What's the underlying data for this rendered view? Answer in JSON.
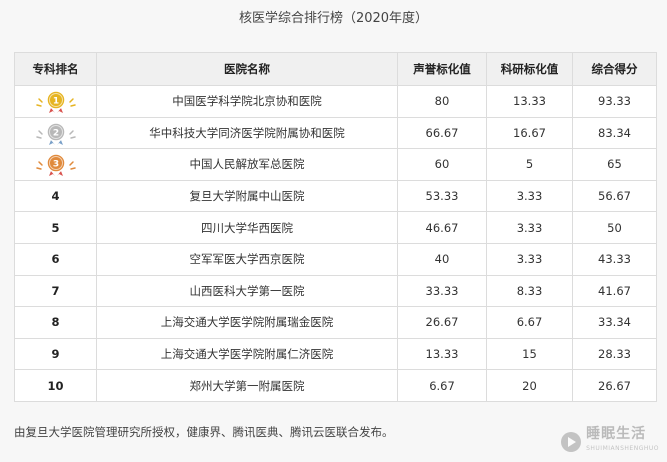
{
  "title": "核医学综合排行榜（2020年度）",
  "headers": [
    "专科排名",
    "医院名称",
    "声誉标化值",
    "科研标化值",
    "综合得分"
  ],
  "rows": [
    {
      "rank": "1",
      "medal": "gold",
      "hospital": "中国医学科学院北京协和医院",
      "reputation": "80",
      "research": "13.33",
      "total": "93.33"
    },
    {
      "rank": "2",
      "medal": "silver",
      "hospital": "华中科技大学同济医学院附属协和医院",
      "reputation": "66.67",
      "research": "16.67",
      "total": "83.34"
    },
    {
      "rank": "3",
      "medal": "bronze",
      "hospital": "中国人民解放军总医院",
      "reputation": "60",
      "research": "5",
      "total": "65"
    },
    {
      "rank": "4",
      "hospital": "复旦大学附属中山医院",
      "reputation": "53.33",
      "research": "3.33",
      "total": "56.67"
    },
    {
      "rank": "5",
      "hospital": "四川大学华西医院",
      "reputation": "46.67",
      "research": "3.33",
      "total": "50"
    },
    {
      "rank": "6",
      "hospital": "空军军医大学西京医院",
      "reputation": "40",
      "research": "3.33",
      "total": "43.33"
    },
    {
      "rank": "7",
      "hospital": "山西医科大学第一医院",
      "reputation": "33.33",
      "research": "8.33",
      "total": "41.67"
    },
    {
      "rank": "8",
      "hospital": "上海交通大学医学院附属瑞金医院",
      "reputation": "26.67",
      "research": "6.67",
      "total": "33.34"
    },
    {
      "rank": "9",
      "hospital": "上海交通大学医学院附属仁济医院",
      "reputation": "13.33",
      "research": "15",
      "total": "28.33"
    },
    {
      "rank": "10",
      "hospital": "郑州大学第一附属医院",
      "reputation": "6.67",
      "research": "20",
      "total": "26.67"
    }
  ],
  "footer": "由复旦大学医院管理研究所授权，健康界、腾讯医典、腾讯云医联合发布。",
  "watermark": {
    "name": "睡眠生活",
    "sub": "SHUIMIANSHENGHUO"
  },
  "colors": {
    "gold": "#e6b422",
    "silver": "#b8b8b8",
    "bronze": "#e08a3c"
  }
}
